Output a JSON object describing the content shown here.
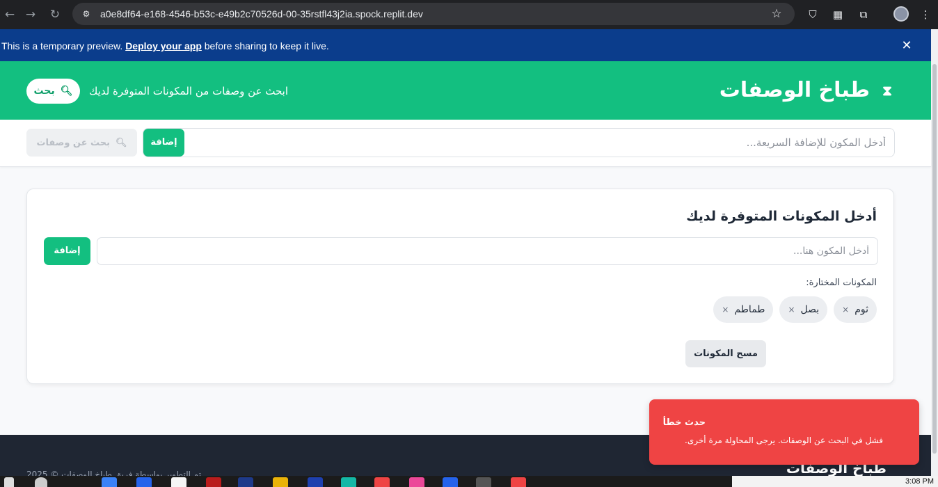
{
  "browser": {
    "url": "a0e8df64-e168-4546-b53c-e49b2c70526d-00-35rstfl43j2ia.spock.replit.dev",
    "icons": [
      "back-icon",
      "forward-icon",
      "reload-icon",
      "site-info-icon",
      "bookmark-star-icon",
      "shield-extension-icon",
      "qr-extension-icon",
      "puzzle-extension-icon",
      "menu-dots-icon"
    ]
  },
  "banner": {
    "prefix": "This is a temporary preview.",
    "link": "Deploy your app",
    "suffix": "before sharing to keep it live.",
    "close": "✕"
  },
  "header": {
    "title": "طباخ الوصفات",
    "tagline": "ابحث عن وصفات من المكونات المتوفرة لديك",
    "search_label": "بحث"
  },
  "quick_bar": {
    "placeholder": "أدخل المكون للإضافة السريعة...",
    "add_label": "إضافة",
    "search_recipes_label": "بحث عن وصفات"
  },
  "card": {
    "title": "أدخل المكونات المتوفرة لديك",
    "input_placeholder": "أدخل المكون هنا...",
    "add_label": "إضافة",
    "selected_label": "المكونات المختارة:",
    "chips": [
      {
        "label": "ثوم",
        "remove": "×"
      },
      {
        "label": "بصل",
        "remove": "×"
      },
      {
        "label": "طماطم",
        "remove": "×"
      }
    ],
    "clear_label": "مسح المكونات"
  },
  "footer": {
    "brand": "طباخ الوصفات",
    "copyright": "تم التطوير بواسطة فريق طباخ الوصفات © 2025"
  },
  "toast": {
    "title": "حدث خطأ",
    "message": "فشل في البحث عن الوصفات. يرجى المحاولة مرة أخرى."
  },
  "taskbar": {
    "clock": "3:08 PM"
  },
  "colors": {
    "brand_green": "#13bf80",
    "banner_blue": "#0b3d8c",
    "error_red": "#ef4444",
    "footer_dark": "#1f2633"
  }
}
